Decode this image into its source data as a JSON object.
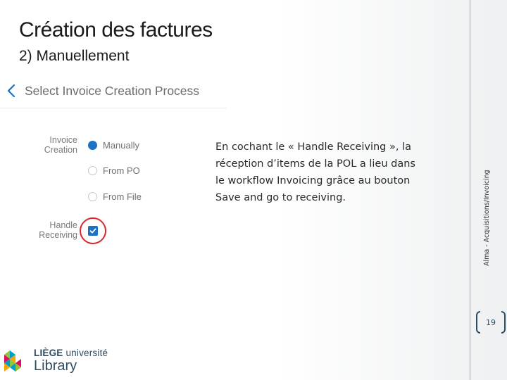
{
  "slide": {
    "title": "Création des factures",
    "subtitle": "2) Manuellement"
  },
  "screenshot": {
    "header_title": "Select Invoice Creation Process",
    "invoice_creation_label": "Invoice Creation",
    "radio_options": [
      {
        "label": "Manually",
        "selected": true
      },
      {
        "label": "From PO",
        "selected": false
      },
      {
        "label": "From File",
        "selected": false
      }
    ],
    "handle_receiving_label": "Handle Receiving",
    "handle_receiving_checked": true,
    "accent_color": "#1c73c4",
    "highlight_color": "#d9262a"
  },
  "note": "En cochant le « Handle Receiving », la réception d’items de la POL a lieu dans le workflow Invoicing grâce au bouton Save and go to receiving.",
  "sidebar": {
    "vertical_label": "Alma - Acquisitions/Invoicing",
    "page_number": "19"
  },
  "logo": {
    "line1_bold": "LIÈGE",
    "line1_regular": " université",
    "line2": "Library"
  }
}
